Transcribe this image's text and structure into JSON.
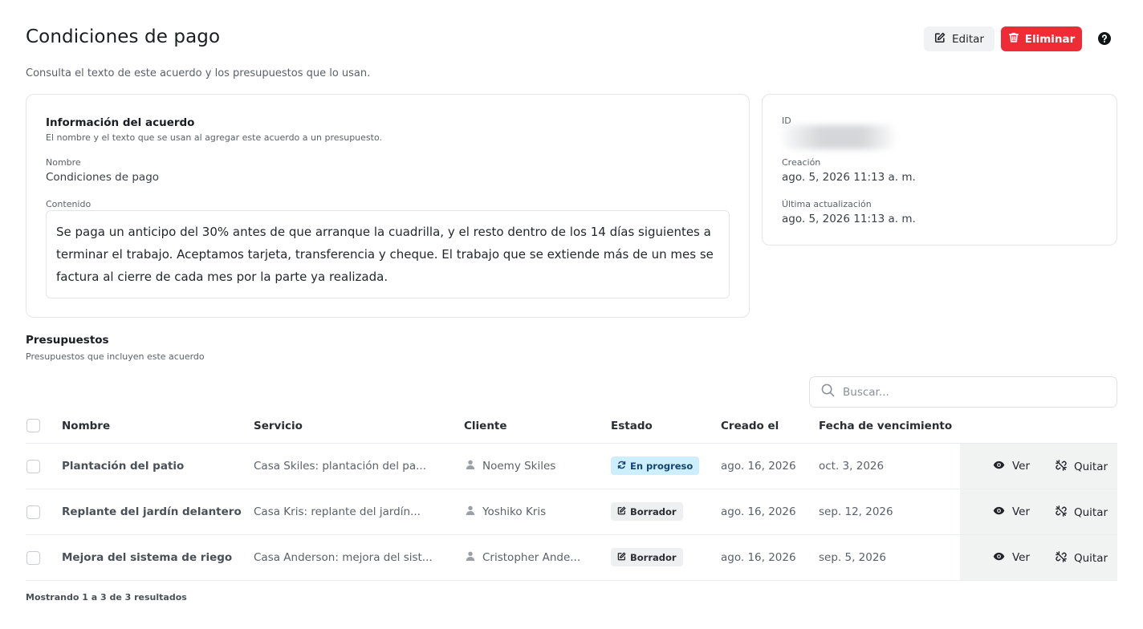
{
  "page": {
    "title": "Condiciones de pago",
    "subtitle": "Consulta el texto de este acuerdo y los presupuestos que lo usan."
  },
  "toolbar": {
    "edit_label": "Editar",
    "delete_label": "Eliminar",
    "help_icon": "help-circle-icon"
  },
  "agreement": {
    "title": "Información del acuerdo",
    "description": "El nombre y el texto que se usan al agregar este acuerdo a un presupuesto.",
    "name_label": "Nombre",
    "name_value": "Condiciones de pago",
    "content_label": "Contenido",
    "content_value": "Se paga un anticipo del 30% antes de que arranque la cuadrilla, y el resto dentro de los 14 días siguientes a terminar el trabajo. Aceptamos tarjeta, transferencia y cheque. El trabajo que se extiende más de un mes se factura al cierre de cada mes por la parte ya realizada."
  },
  "meta": {
    "id_label": "ID",
    "created_label": "Creación",
    "created_value": "ago. 5, 2026 11:13 a. m.",
    "updated_label": "Última actualización",
    "updated_value": "ago. 5, 2026 11:13 a. m."
  },
  "quotes": {
    "title": "Presupuestos",
    "description": "Presupuestos que incluyen este acuerdo",
    "search_placeholder": "Buscar...",
    "columns": {
      "name": "Nombre",
      "service": "Servicio",
      "client": "Cliente",
      "status": "Estado",
      "created": "Creado el",
      "due": "Fecha de vencimiento"
    },
    "rows": [
      {
        "name": "Plantación del patio",
        "service": "Casa Skiles: plantación del pa...",
        "client": "Noemy Skiles",
        "status": "En progreso",
        "created": "ago. 16, 2026",
        "due": "oct. 3, 2026",
        "view": "Ver",
        "remove": "Quitar"
      },
      {
        "name": "Replante del jardín delantero",
        "service": "Casa Kris: replante del jardín...",
        "client": "Yoshiko Kris",
        "status": "Borrador",
        "created": "ago. 16, 2026",
        "due": "sep. 12, 2026",
        "view": "Ver",
        "remove": "Quitar"
      },
      {
        "name": "Mejora del sistema de riego",
        "service": "Casa Anderson: mejora del sist...",
        "client": "Cristopher Ande...",
        "status": "Borrador",
        "created": "ago. 16, 2026",
        "due": "sep. 5, 2026",
        "view": "Ver",
        "remove": "Quitar"
      }
    ],
    "footer": "Mostrando 1 a 3 de 3 resultados"
  },
  "colors": {
    "danger": "#ef2b36",
    "badge_progress_bg": "#cdeefc",
    "badge_draft_bg": "#eeeff1",
    "actions_bg": "#f1f2f2"
  }
}
